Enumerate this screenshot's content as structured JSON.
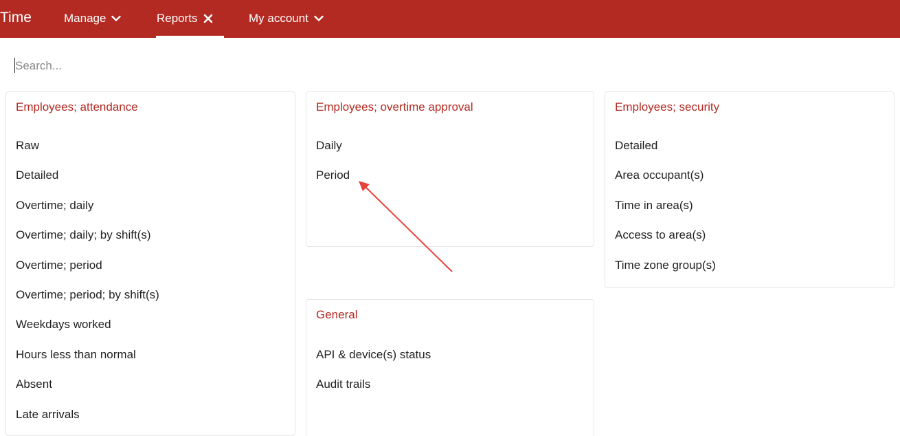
{
  "header": {
    "brand": "Time",
    "nav": [
      {
        "label": "Manage",
        "icon": "chevron-down-icon"
      },
      {
        "label": "Reports",
        "icon": "close-icon",
        "active": true
      },
      {
        "label": "My account",
        "icon": "chevron-down-icon"
      }
    ],
    "color": "#b22a22"
  },
  "search": {
    "placeholder": "Search...",
    "value": ""
  },
  "sections": [
    {
      "title": "Employees; attendance",
      "items": [
        "Raw",
        "Detailed",
        "Overtime; daily",
        "Overtime; daily; by shift(s)",
        "Overtime; period",
        "Overtime; period; by shift(s)",
        "Weekdays worked",
        "Hours less than normal",
        "Absent",
        "Late arrivals"
      ]
    },
    {
      "title": "Employees; overtime approval",
      "items": [
        "Daily",
        "Period"
      ]
    },
    {
      "title": "Employees; security",
      "items": [
        "Detailed",
        "Area occupant(s)",
        "Time in area(s)",
        "Access to area(s)",
        "Time zone group(s)"
      ]
    },
    {
      "title": "General",
      "items": [
        "API & device(s) status",
        "Audit trails"
      ]
    }
  ],
  "annotation": {
    "type": "arrow",
    "color": "#e8433a",
    "target": "Period"
  },
  "colors": {
    "accent": "#b22a22",
    "text": "#222222",
    "border": "#e6e6e6"
  }
}
